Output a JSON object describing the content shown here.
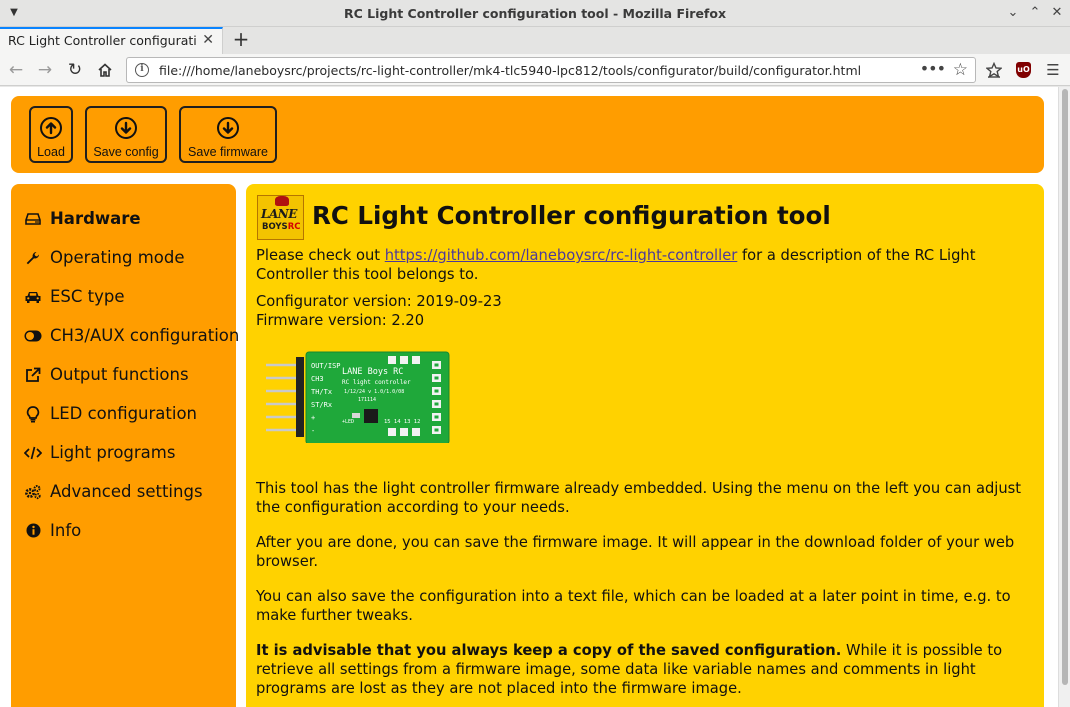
{
  "window": {
    "title": "RC Light Controller configuration tool - Mozilla Firefox"
  },
  "tab": {
    "label": "RC Light Controller configuration t",
    "close_icon": "close-icon"
  },
  "navbar": {
    "url": "file:///home/laneboysrc/projects/rc-light-controller/mk4-tlc5940-lpc812/tools/configurator/build/configurator.html",
    "more_dots": "•••"
  },
  "toolbar": {
    "buttons": [
      {
        "label": "Load",
        "icon": "arrow-up-circle-icon"
      },
      {
        "label": "Save config",
        "icon": "arrow-down-circle-icon"
      },
      {
        "label": "Save firmware",
        "icon": "arrow-down-circle-icon"
      }
    ]
  },
  "sidebar": {
    "items": [
      {
        "label": "Hardware",
        "icon": "hdd-icon",
        "active": true
      },
      {
        "label": "Operating mode",
        "icon": "wrench-icon"
      },
      {
        "label": "ESC type",
        "icon": "car-icon"
      },
      {
        "label": "CH3/AUX configuration",
        "icon": "toggle-icon"
      },
      {
        "label": "Output functions",
        "icon": "external-link-icon"
      },
      {
        "label": "LED configuration",
        "icon": "lightbulb-icon"
      },
      {
        "label": "Light programs",
        "icon": "code-icon"
      },
      {
        "label": "Advanced settings",
        "icon": "cogs-icon"
      },
      {
        "label": "Info",
        "icon": "info-circle-icon"
      }
    ]
  },
  "main": {
    "logo": {
      "line1": "LANE",
      "line2a": "BOYS",
      "line2b": "RC"
    },
    "heading": "RC Light Controller configuration tool",
    "intro_before": "Please check out ",
    "intro_link": "https://github.com/laneboysrc/rc-light-controller",
    "intro_after": " for a description of the RC Light Controller this tool belongs to.",
    "configurator_version": "Configurator version: 2019-09-23",
    "firmware_version": "Firmware version: 2.20",
    "board": {
      "left_labels": [
        "OUT/ISP",
        "CH3",
        "TH/Tx",
        "ST/Rx",
        "+",
        "-"
      ],
      "title": "LANE Boys RC",
      "subtitle": "RC light controller",
      "model": "1/12/24 v 1.0/1.0/08",
      "date": "171114",
      "pins_label": "15 14 13 12",
      "led_label": "+LED"
    },
    "para1": "This tool has the light controller firmware already embedded. Using the menu on the left you can adjust the configuration according to your needs.",
    "para2": "After you are done, you can save the firmware image. It will appear in the download folder of your web browser.",
    "para3": "You can also save the configuration into a text file, which can be loaded at a later point in time, e.g. to make further tweaks.",
    "para4_bold": "It is advisable that you always keep a copy of the saved configuration.",
    "para4_rest": " While it is possible to retrieve all settings from a firmware image, some data like variable names and comments in light programs are lost as they are not placed into the firmware image."
  }
}
